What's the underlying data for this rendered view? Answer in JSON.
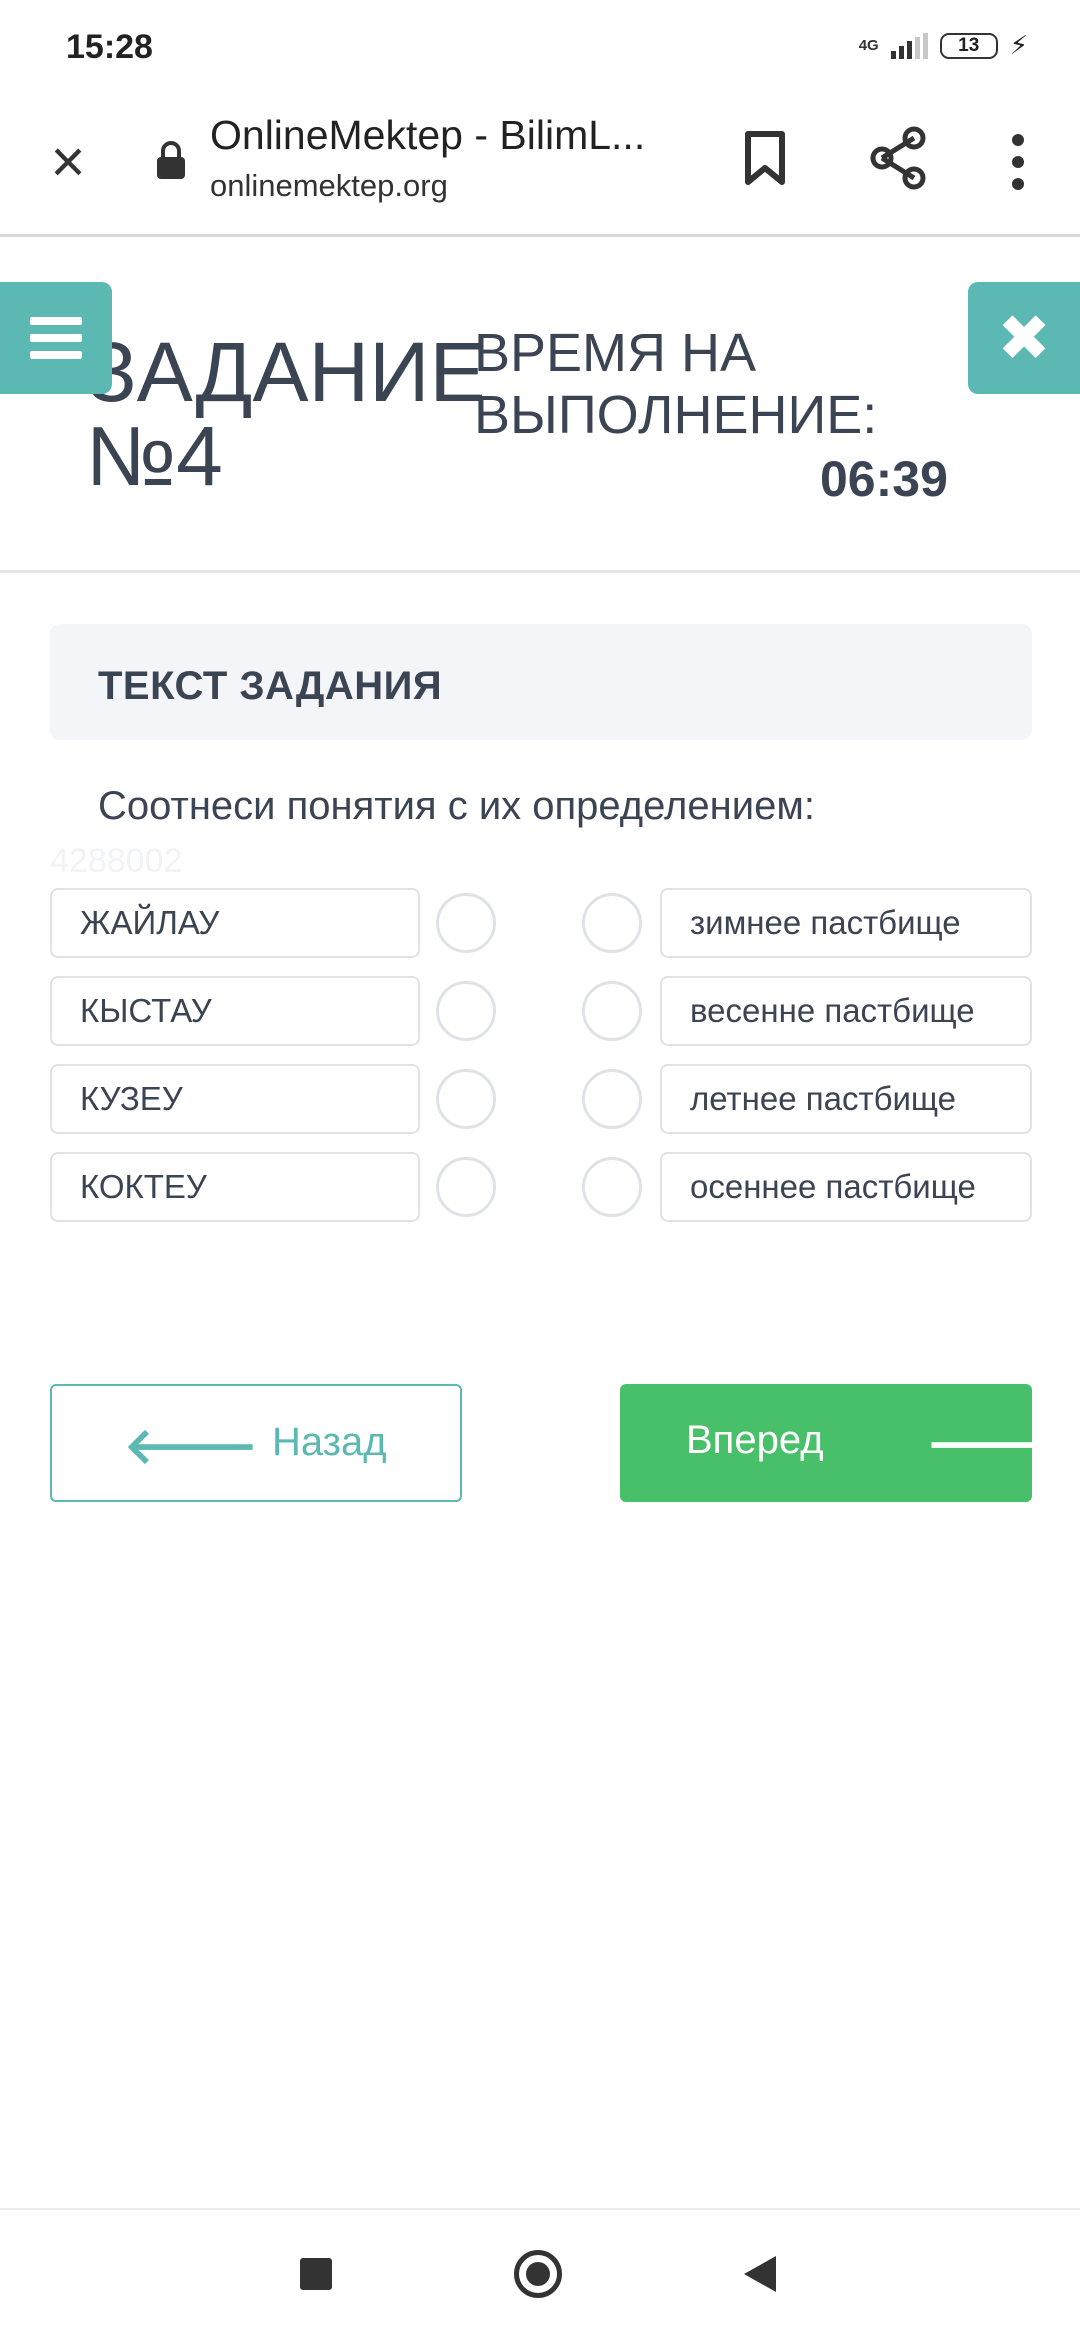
{
  "status_bar": {
    "time": "15:28",
    "network": "4G",
    "battery": "13"
  },
  "browser": {
    "title": "OnlineMektep - BilimL...",
    "url": "onlinemektep.org"
  },
  "header": {
    "task_title": "ЗАДАНИЕ №4",
    "timer_label": "ВРЕМЯ НА ВЫПОЛНЕНИЕ:",
    "timer_value": "06:39"
  },
  "task": {
    "box_label": "ТЕКСТ ЗАДАНИЯ",
    "question": "Соотнеси понятия с их определением:",
    "id_watermark": "4288002",
    "terms": [
      "ЖАЙЛАУ",
      "КЫСТАУ",
      "КУЗЕУ",
      "КОКТЕУ"
    ],
    "definitions": [
      "зимнее пастбище",
      "весенне пастбище",
      "летнее пастбище",
      "осеннее пастбище"
    ]
  },
  "navigation": {
    "back_label": "Назад",
    "next_label": "Вперед"
  },
  "colors": {
    "accent": "#5cb8b2",
    "next_button": "#48c06a",
    "text": "#3b4452"
  }
}
